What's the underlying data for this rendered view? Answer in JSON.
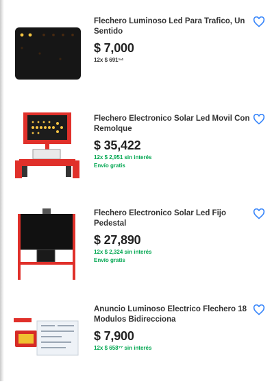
{
  "items": [
    {
      "title": "Flechero Luminoso Led Para Trafico, Un Sentido",
      "price": "$ 7,000",
      "installments": "12x $ 691⁵⁴",
      "installments_green": false,
      "shipping": ""
    },
    {
      "title": "Flechero Electronico Solar Led Movil Con Remolque",
      "price": "$ 35,422",
      "installments": "12x $ 2,951 sin interés",
      "installments_green": true,
      "shipping": "Envío gratis"
    },
    {
      "title": "Flechero Electronico Solar Led Fijo Pedestal",
      "price": "$ 27,890",
      "installments": "12x $ 2,324 sin interés",
      "installments_green": true,
      "shipping": "Envío gratis"
    },
    {
      "title": "Anuncio Luminoso Electrico Flechero 18 Modulos Bidirecciona",
      "price": "$ 7,900",
      "installments": "12x $ 658⁷⁷ sin interés",
      "installments_green": true,
      "shipping": ""
    }
  ],
  "colors": {
    "accent_heart": "#3483fa",
    "free_shipping_green": "#00a650",
    "product_red": "#e0302a"
  },
  "icons": {
    "favorite": "heart-outline-icon"
  }
}
